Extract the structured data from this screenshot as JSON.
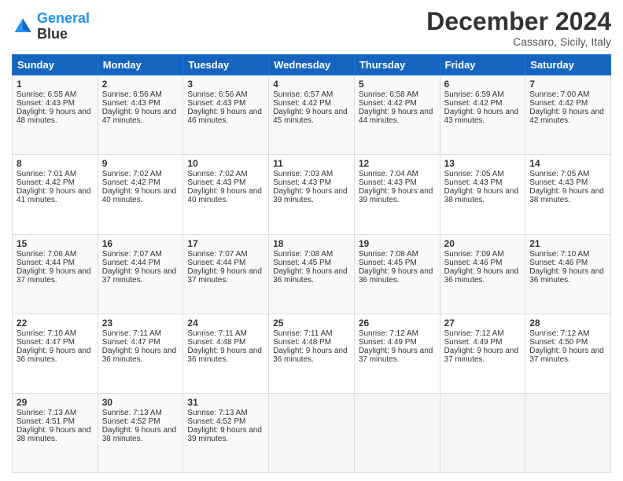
{
  "header": {
    "logo_line1": "General",
    "logo_line2": "Blue",
    "month_title": "December 2024",
    "location": "Cassaro, Sicily, Italy"
  },
  "days_of_week": [
    "Sunday",
    "Monday",
    "Tuesday",
    "Wednesday",
    "Thursday",
    "Friday",
    "Saturday"
  ],
  "weeks": [
    [
      {
        "day": 1,
        "info": "Sunrise: 6:55 AM\nSunset: 4:43 PM\nDaylight: 9 hours and 48 minutes."
      },
      {
        "day": 2,
        "info": "Sunrise: 6:56 AM\nSunset: 4:43 PM\nDaylight: 9 hours and 47 minutes."
      },
      {
        "day": 3,
        "info": "Sunrise: 6:56 AM\nSunset: 4:43 PM\nDaylight: 9 hours and 46 minutes."
      },
      {
        "day": 4,
        "info": "Sunrise: 6:57 AM\nSunset: 4:42 PM\nDaylight: 9 hours and 45 minutes."
      },
      {
        "day": 5,
        "info": "Sunrise: 6:58 AM\nSunset: 4:42 PM\nDaylight: 9 hours and 44 minutes."
      },
      {
        "day": 6,
        "info": "Sunrise: 6:59 AM\nSunset: 4:42 PM\nDaylight: 9 hours and 43 minutes."
      },
      {
        "day": 7,
        "info": "Sunrise: 7:00 AM\nSunset: 4:42 PM\nDaylight: 9 hours and 42 minutes."
      }
    ],
    [
      {
        "day": 8,
        "info": "Sunrise: 7:01 AM\nSunset: 4:42 PM\nDaylight: 9 hours and 41 minutes."
      },
      {
        "day": 9,
        "info": "Sunrise: 7:02 AM\nSunset: 4:42 PM\nDaylight: 9 hours and 40 minutes."
      },
      {
        "day": 10,
        "info": "Sunrise: 7:02 AM\nSunset: 4:43 PM\nDaylight: 9 hours and 40 minutes."
      },
      {
        "day": 11,
        "info": "Sunrise: 7:03 AM\nSunset: 4:43 PM\nDaylight: 9 hours and 39 minutes."
      },
      {
        "day": 12,
        "info": "Sunrise: 7:04 AM\nSunset: 4:43 PM\nDaylight: 9 hours and 39 minutes."
      },
      {
        "day": 13,
        "info": "Sunrise: 7:05 AM\nSunset: 4:43 PM\nDaylight: 9 hours and 38 minutes."
      },
      {
        "day": 14,
        "info": "Sunrise: 7:05 AM\nSunset: 4:43 PM\nDaylight: 9 hours and 38 minutes."
      }
    ],
    [
      {
        "day": 15,
        "info": "Sunrise: 7:06 AM\nSunset: 4:44 PM\nDaylight: 9 hours and 37 minutes."
      },
      {
        "day": 16,
        "info": "Sunrise: 7:07 AM\nSunset: 4:44 PM\nDaylight: 9 hours and 37 minutes."
      },
      {
        "day": 17,
        "info": "Sunrise: 7:07 AM\nSunset: 4:44 PM\nDaylight: 9 hours and 37 minutes."
      },
      {
        "day": 18,
        "info": "Sunrise: 7:08 AM\nSunset: 4:45 PM\nDaylight: 9 hours and 36 minutes."
      },
      {
        "day": 19,
        "info": "Sunrise: 7:08 AM\nSunset: 4:45 PM\nDaylight: 9 hours and 36 minutes."
      },
      {
        "day": 20,
        "info": "Sunrise: 7:09 AM\nSunset: 4:46 PM\nDaylight: 9 hours and 36 minutes."
      },
      {
        "day": 21,
        "info": "Sunrise: 7:10 AM\nSunset: 4:46 PM\nDaylight: 9 hours and 36 minutes."
      }
    ],
    [
      {
        "day": 22,
        "info": "Sunrise: 7:10 AM\nSunset: 4:47 PM\nDaylight: 9 hours and 36 minutes."
      },
      {
        "day": 23,
        "info": "Sunrise: 7:11 AM\nSunset: 4:47 PM\nDaylight: 9 hours and 36 minutes."
      },
      {
        "day": 24,
        "info": "Sunrise: 7:11 AM\nSunset: 4:48 PM\nDaylight: 9 hours and 36 minutes."
      },
      {
        "day": 25,
        "info": "Sunrise: 7:11 AM\nSunset: 4:48 PM\nDaylight: 9 hours and 36 minutes."
      },
      {
        "day": 26,
        "info": "Sunrise: 7:12 AM\nSunset: 4:49 PM\nDaylight: 9 hours and 37 minutes."
      },
      {
        "day": 27,
        "info": "Sunrise: 7:12 AM\nSunset: 4:49 PM\nDaylight: 9 hours and 37 minutes."
      },
      {
        "day": 28,
        "info": "Sunrise: 7:12 AM\nSunset: 4:50 PM\nDaylight: 9 hours and 37 minutes."
      }
    ],
    [
      {
        "day": 29,
        "info": "Sunrise: 7:13 AM\nSunset: 4:51 PM\nDaylight: 9 hours and 38 minutes."
      },
      {
        "day": 30,
        "info": "Sunrise: 7:13 AM\nSunset: 4:52 PM\nDaylight: 9 hours and 38 minutes."
      },
      {
        "day": 31,
        "info": "Sunrise: 7:13 AM\nSunset: 4:52 PM\nDaylight: 9 hours and 39 minutes."
      },
      null,
      null,
      null,
      null
    ]
  ]
}
